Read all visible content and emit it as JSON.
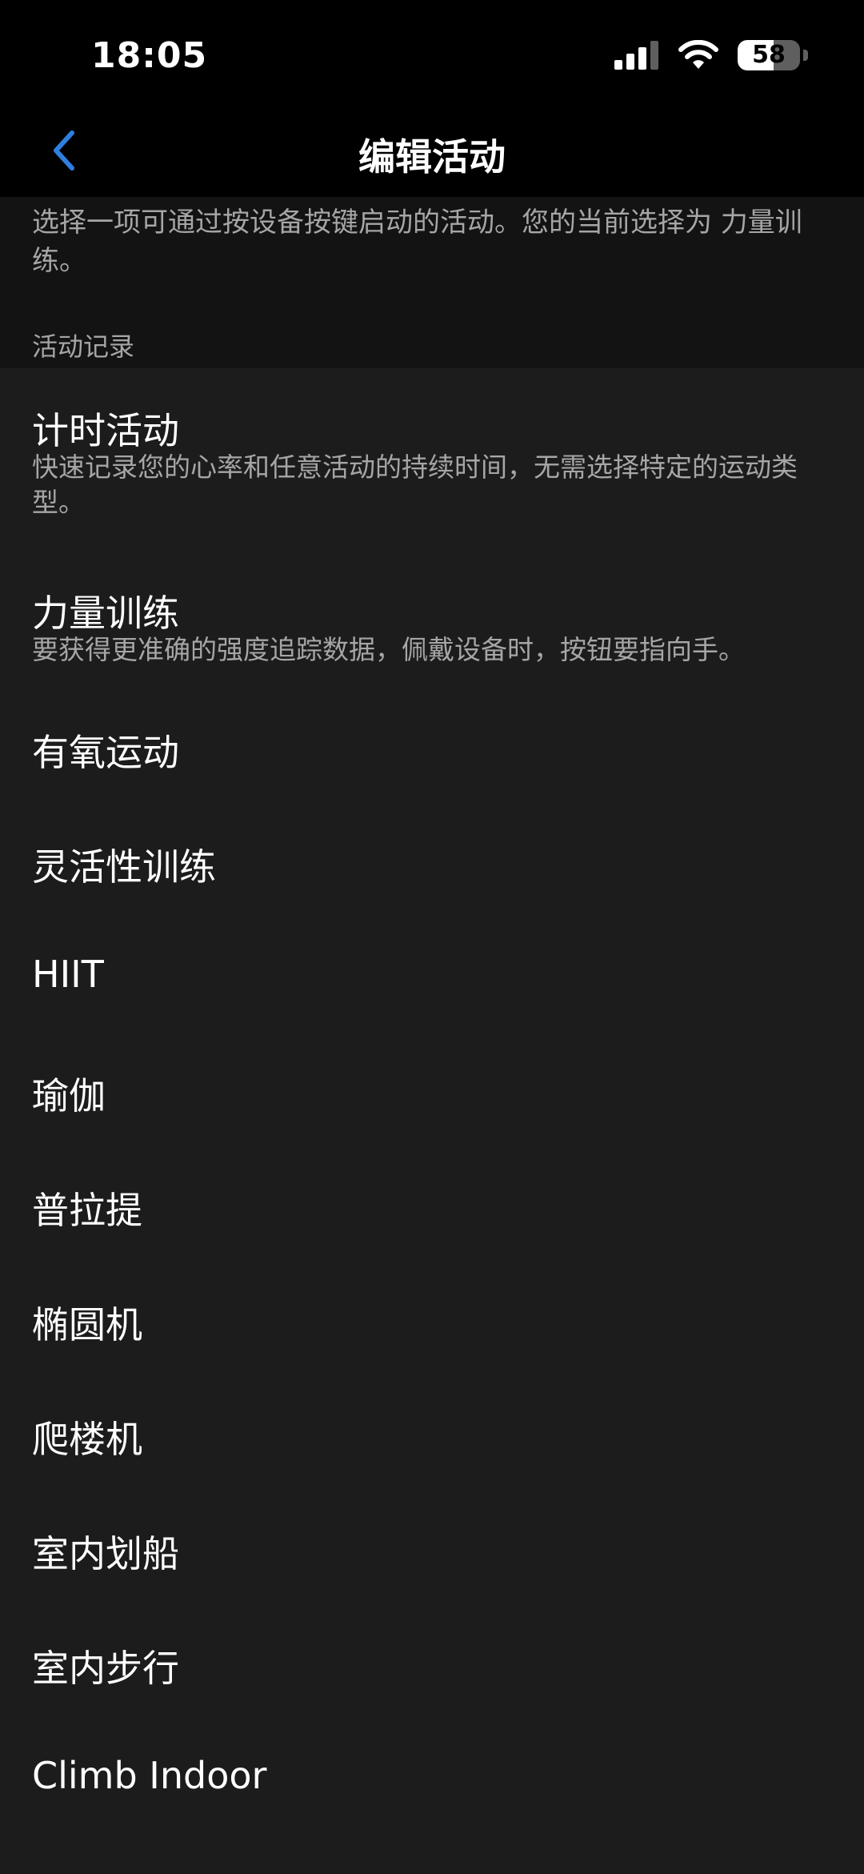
{
  "status_bar": {
    "time": "18:05",
    "battery_level": "58",
    "icons": [
      "signal-icon",
      "wifi-icon",
      "battery-icon"
    ]
  },
  "nav": {
    "back_icon": "chevron-left-icon",
    "title": "编辑活动"
  },
  "intro": {
    "text": "选择一项可通过按设备按键启动的活动。您的当前选择为 力量训练。",
    "section_header": "活动记录"
  },
  "activities": [
    {
      "title": "计时活动",
      "description": "快速记录您的心率和任意活动的持续时间，无需选择特定的运动类型。"
    },
    {
      "title": "力量训练",
      "description": "要获得更准确的强度追踪数据，佩戴设备时，按钮要指向手。"
    },
    {
      "title": "有氧运动"
    },
    {
      "title": "灵活性训练"
    },
    {
      "title": "HIIT"
    },
    {
      "title": "瑜伽"
    },
    {
      "title": "普拉提"
    },
    {
      "title": "椭圆机"
    },
    {
      "title": "爬楼机"
    },
    {
      "title": "室内划船"
    },
    {
      "title": "室内步行"
    },
    {
      "title": "Climb Indoor"
    }
  ],
  "colors": {
    "background": "#000000",
    "list_background": "#1c1c1d",
    "intro_background": "#131313",
    "accent": "#2f7fe0",
    "secondary_text": "#a6a6a6"
  }
}
